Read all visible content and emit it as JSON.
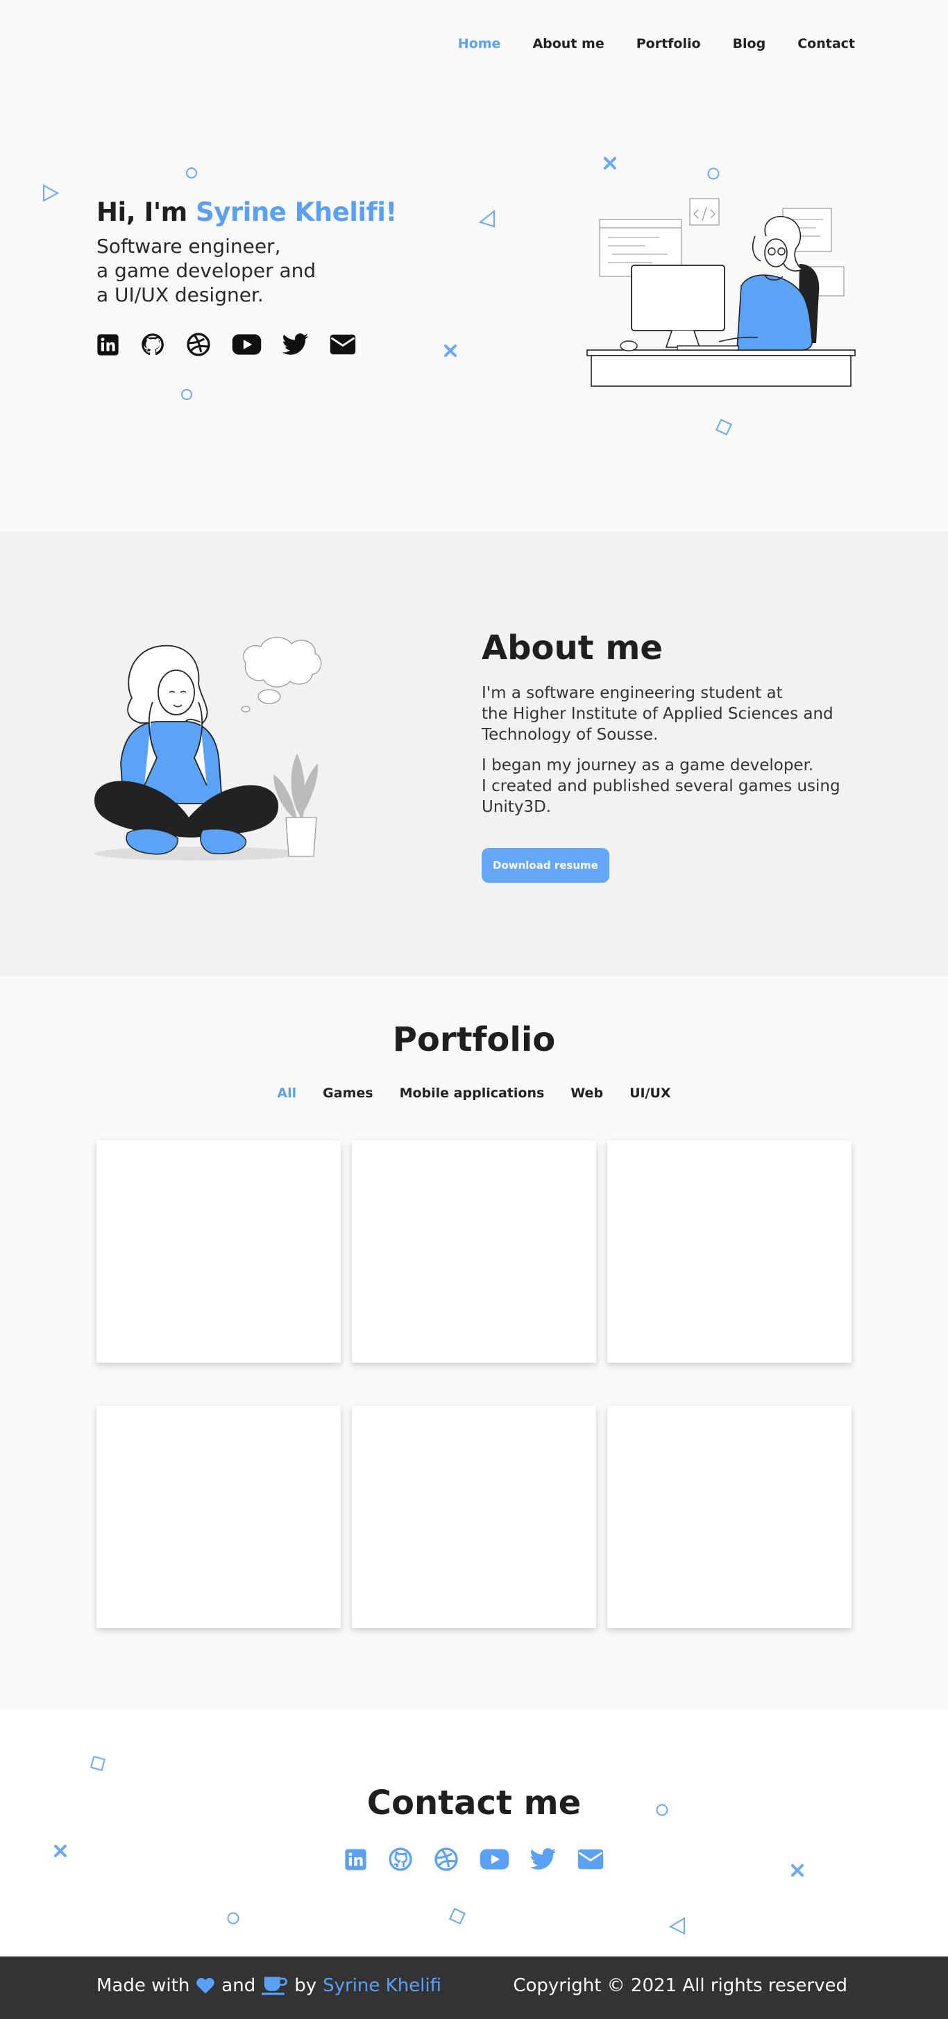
{
  "colors": {
    "accent": "#5aa0f5",
    "button": "#64a6f7",
    "dark": "#1f1f1f",
    "footer_bg": "#333333"
  },
  "nav": {
    "items": [
      {
        "label": "Home",
        "active": true
      },
      {
        "label": "About me",
        "active": false
      },
      {
        "label": "Portfolio",
        "active": false
      },
      {
        "label": "Blog",
        "active": false
      },
      {
        "label": "Contact",
        "active": false
      }
    ]
  },
  "hero": {
    "greeting": "Hi, I'm ",
    "name": "Syrine Khelifi!",
    "sub_line1": "Software engineer,",
    "sub_line2": "a game developer and",
    "sub_line3": "a UI/UX designer.",
    "socials": [
      "linkedin-icon",
      "github-icon",
      "dribbble-icon",
      "youtube-icon",
      "twitter-icon",
      "email-icon"
    ]
  },
  "about": {
    "title": "About me",
    "p1_line1": "I'm a software engineering student at",
    "p1_line2": "the Higher Institute of Applied Sciences and",
    "p1_line3": "Technology of Sousse.",
    "p2_line1": "I began my journey as a game developer.",
    "p2_line2": "I created and published several games using",
    "p2_line3": "Unity3D.",
    "button": "Download resume"
  },
  "portfolio": {
    "title": "Portfolio",
    "tabs": [
      {
        "label": "All",
        "active": true
      },
      {
        "label": "Games",
        "active": false
      },
      {
        "label": "Mobile applications",
        "active": false
      },
      {
        "label": "Web",
        "active": false
      },
      {
        "label": "UI/UX",
        "active": false
      }
    ],
    "card_count": 6
  },
  "contact": {
    "title": "Contact me",
    "socials": [
      "linkedin-icon",
      "github-icon",
      "dribbble-icon",
      "youtube-icon",
      "twitter-icon",
      "email-icon"
    ]
  },
  "footer": {
    "made_with": "Made with",
    "and": "and",
    "by": "by",
    "author": "Syrine Khelifi",
    "copyright": "Copyright © 2021 All rights reserved",
    "icons": [
      "heart-icon",
      "coffee-icon"
    ]
  }
}
